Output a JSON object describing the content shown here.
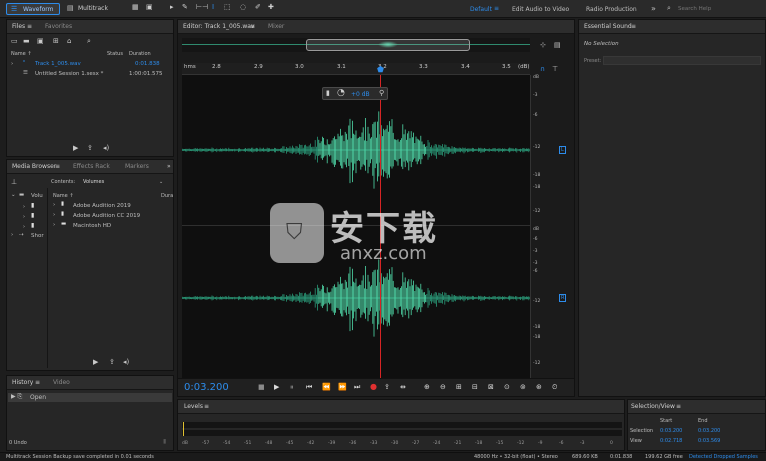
{
  "toolbar": {
    "waveform_label": "Waveform",
    "multitrack_label": "Multitrack",
    "workspaces": [
      "Default",
      "Edit Audio to Video",
      "Radio Production"
    ],
    "more": "»",
    "search_placeholder": "Search Help"
  },
  "files": {
    "tabs": [
      "Files",
      "Favorites"
    ],
    "col_name": "Name ↑",
    "col_status": "Status",
    "col_duration": "Duration",
    "items": [
      {
        "name": "Track 1_005.wav",
        "duration": "0:01.838"
      },
      {
        "name": "Untitled Session 1.sesx *",
        "duration": "1:00:01.575"
      }
    ]
  },
  "media": {
    "tabs": [
      "Media Browser",
      "Effects Rack",
      "Markers"
    ],
    "more": "»",
    "contents_label": "Contents:",
    "contents_value": "Volumes",
    "tree_items": [
      "Volu",
      "Shor"
    ],
    "col_name": "Name ↑",
    "col_dura": "Dura",
    "items": [
      "Adobe Audition 2019",
      "Adobe Audition CC 2019",
      "Macintosh HD"
    ]
  },
  "history": {
    "tabs": [
      "History",
      "Video"
    ],
    "items": [
      "Open"
    ],
    "undo_count": "0 Undo"
  },
  "editor": {
    "tab_label": "Editor: Track 1_005.wav",
    "mixer_label": "Mixer",
    "ruler_unit": "hms",
    "ruler_end": "(dB)",
    "ruler_ticks": [
      "2.8",
      "2.9",
      "3.0",
      "3.1",
      "3.2",
      "3.3",
      "3.4",
      "3.5"
    ],
    "db_upper": [
      "dB",
      "-3",
      "-6",
      "-12",
      "-18",
      "-18",
      "-12",
      "-6",
      "-3"
    ],
    "db_lower": [
      "dB",
      "-3",
      "-6",
      "-12",
      "-18",
      "-18",
      "-12",
      "-6",
      "-3"
    ],
    "channel_l": "L",
    "channel_r": "R",
    "hud_gain": "+0 dB",
    "time_display": "0:03.200",
    "watermark_cn": "安下载",
    "watermark_url": "anxz.com"
  },
  "levels": {
    "title": "Levels",
    "ticks": [
      "dB",
      "-57",
      "-54",
      "-51",
      "-48",
      "-45",
      "-42",
      "-39",
      "-36",
      "-33",
      "-30",
      "-27",
      "-24",
      "-21",
      "-18",
      "-15",
      "-12",
      "-9",
      "-6",
      "-3",
      "0"
    ]
  },
  "essential": {
    "title": "Essential Sound",
    "no_selection": "No Selection",
    "preset_label": "Preset:"
  },
  "selection": {
    "title": "Selection/View",
    "col_start": "Start",
    "col_end": "End",
    "selection_label": "Selection",
    "selection_start": "0:03.200",
    "selection_end": "0:03.200",
    "view_label": "View",
    "view_start": "0:02.718",
    "view_end": "0:03.569"
  },
  "status": {
    "message": "Multitrack Session Backup save completed in 0.01 seconds",
    "format": "48000 Hz • 32-bit (float) • Stereo",
    "size": "689.60 KB",
    "duration": "0:01.838",
    "free": "199.62 GB free",
    "dropped": "Detected Dropped Samples"
  }
}
